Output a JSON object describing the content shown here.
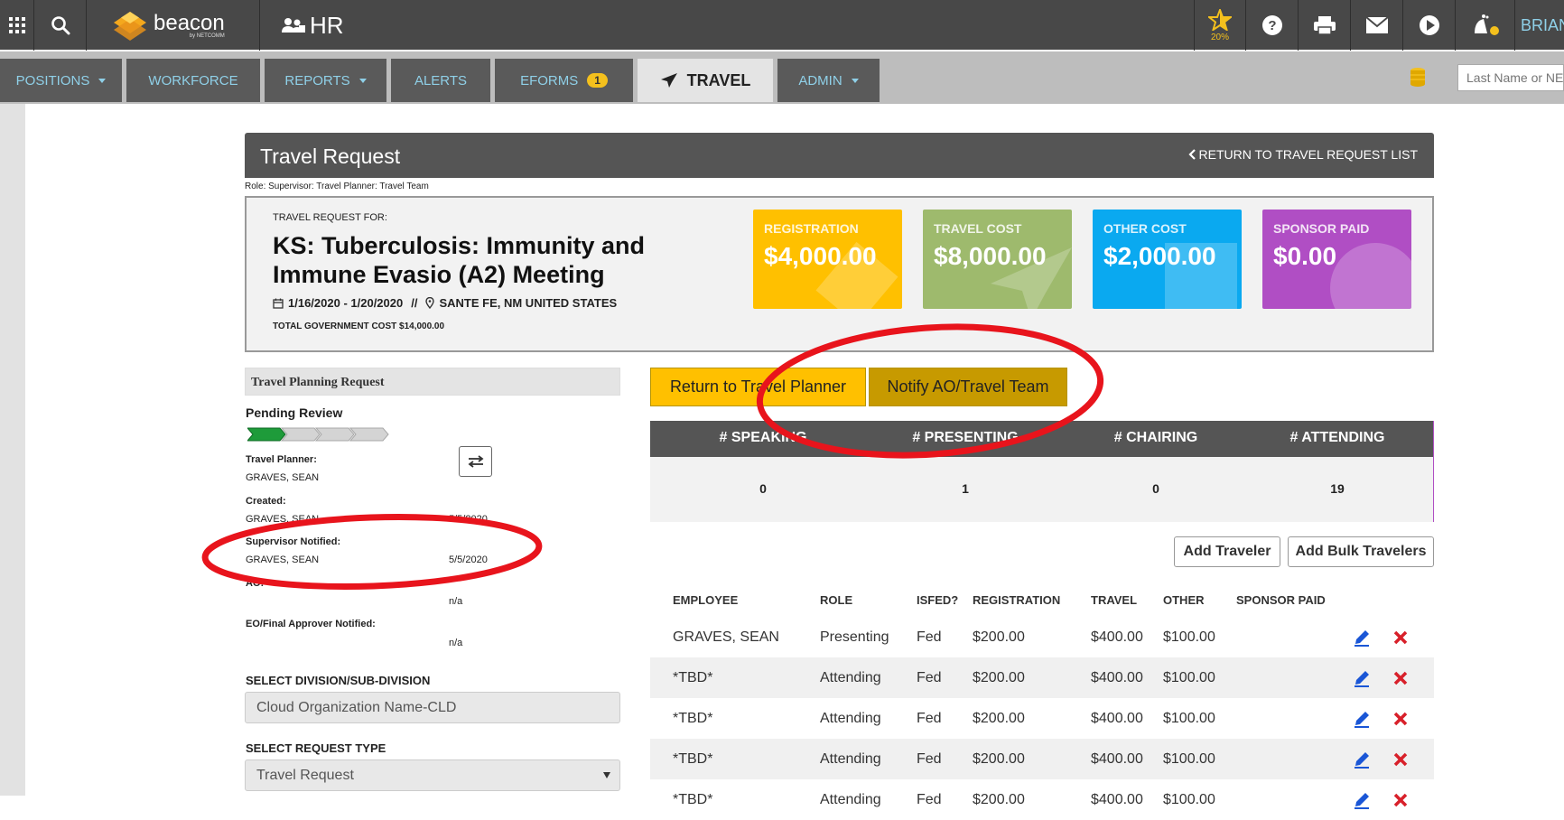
{
  "topbar": {
    "app_name": "beacon",
    "app_sub": "by NETCOMM",
    "module": "HR",
    "star_pct": "20%",
    "user": "BRIAN"
  },
  "nav": {
    "positions": "POSITIONS",
    "workforce": "WORKFORCE",
    "reports": "REPORTS",
    "alerts": "ALERTS",
    "eforms": "EFORMS",
    "eforms_badge": "1",
    "travel": "TRAVEL",
    "admin": "ADMIN",
    "search_placeholder": "Last Name or NED"
  },
  "header": {
    "title": "Travel Request",
    "return_link": "RETURN TO TRAVEL REQUEST LIST",
    "role_line": "Role: Supervisor: Travel Planner: Travel Team"
  },
  "summary": {
    "for_label": "TRAVEL REQUEST FOR:",
    "title_line1": "KS: Tuberculosis: Immunity and",
    "title_line2": "Immune Evasio (A2) Meeting",
    "dates": "1/16/2020 - 1/20/2020",
    "separator": "//",
    "location": "SANTE FE, NM UNITED STATES",
    "total_cost": "TOTAL GOVERNMENT COST $14,000.00"
  },
  "cards": [
    {
      "label": "REGISTRATION",
      "value": "$4,000.00",
      "color": "#ffc000"
    },
    {
      "label": "TRAVEL COST",
      "value": "$8,000.00",
      "color": "#9eba6d"
    },
    {
      "label": "OTHER COST",
      "value": "$2,000.00",
      "color": "#0aa9f0"
    },
    {
      "label": "SPONSOR PAID",
      "value": "$0.00",
      "color": "#b04ec4"
    }
  ],
  "planning": {
    "section_title": "Travel Planning Request",
    "status": "Pending Review",
    "progress_steps_done": 1,
    "progress_steps_total": 4,
    "travel_planner_label": "Travel Planner:",
    "travel_planner_value": "GRAVES, SEAN",
    "created_label": "Created:",
    "created_value": "GRAVES, SEAN",
    "created_date": "5/5/2020",
    "supervisor_label": "Supervisor Notified:",
    "supervisor_value": "GRAVES, SEAN",
    "supervisor_date": "5/5/2020",
    "ao_label": "AO:",
    "ao_date": "n/a",
    "eo_label": "EO/Final Approver Notified:",
    "eo_date": "n/a",
    "division_label": "SELECT DIVISION/SUB-DIVISION",
    "division_value": "Cloud Organization Name-CLD",
    "request_type_label": "SELECT REQUEST TYPE",
    "request_type_value": "Travel Request"
  },
  "actions": {
    "return_planner": "Return to Travel Planner",
    "notify": "Notify AO/Travel Team",
    "add_traveler": "Add Traveler",
    "add_bulk": "Add Bulk Travelers"
  },
  "stats": {
    "headers": [
      "# SPEAKING",
      "# PRESENTING",
      "# CHAIRING",
      "# ATTENDING"
    ],
    "values": [
      "0",
      "1",
      "0",
      "19"
    ]
  },
  "table": {
    "headers": [
      "EMPLOYEE",
      "ROLE",
      "ISFED?",
      "REGISTRATION",
      "TRAVEL",
      "OTHER",
      "SPONSOR PAID"
    ],
    "rows": [
      [
        "GRAVES, SEAN",
        "Presenting",
        "Fed",
        "$200.00",
        "$400.00",
        "$100.00",
        ""
      ],
      [
        "*TBD*",
        "Attending",
        "Fed",
        "$200.00",
        "$400.00",
        "$100.00",
        ""
      ],
      [
        "*TBD*",
        "Attending",
        "Fed",
        "$200.00",
        "$400.00",
        "$100.00",
        ""
      ],
      [
        "*TBD*",
        "Attending",
        "Fed",
        "$200.00",
        "$400.00",
        "$100.00",
        ""
      ],
      [
        "*TBD*",
        "Attending",
        "Fed",
        "$200.00",
        "$400.00",
        "$100.00",
        ""
      ]
    ]
  }
}
